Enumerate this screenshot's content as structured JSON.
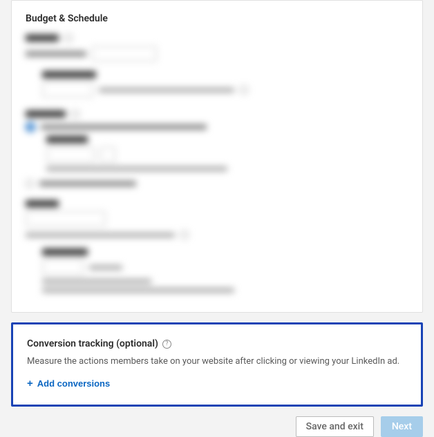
{
  "budget_schedule": {
    "title": "Budget & Schedule"
  },
  "conversion": {
    "title": "Conversion tracking (optional)",
    "description": "Measure the actions members take on your website after clicking or viewing your LinkedIn ad.",
    "add_label": "Add conversions"
  },
  "footer": {
    "save_exit": "Save and exit",
    "next": "Next"
  }
}
